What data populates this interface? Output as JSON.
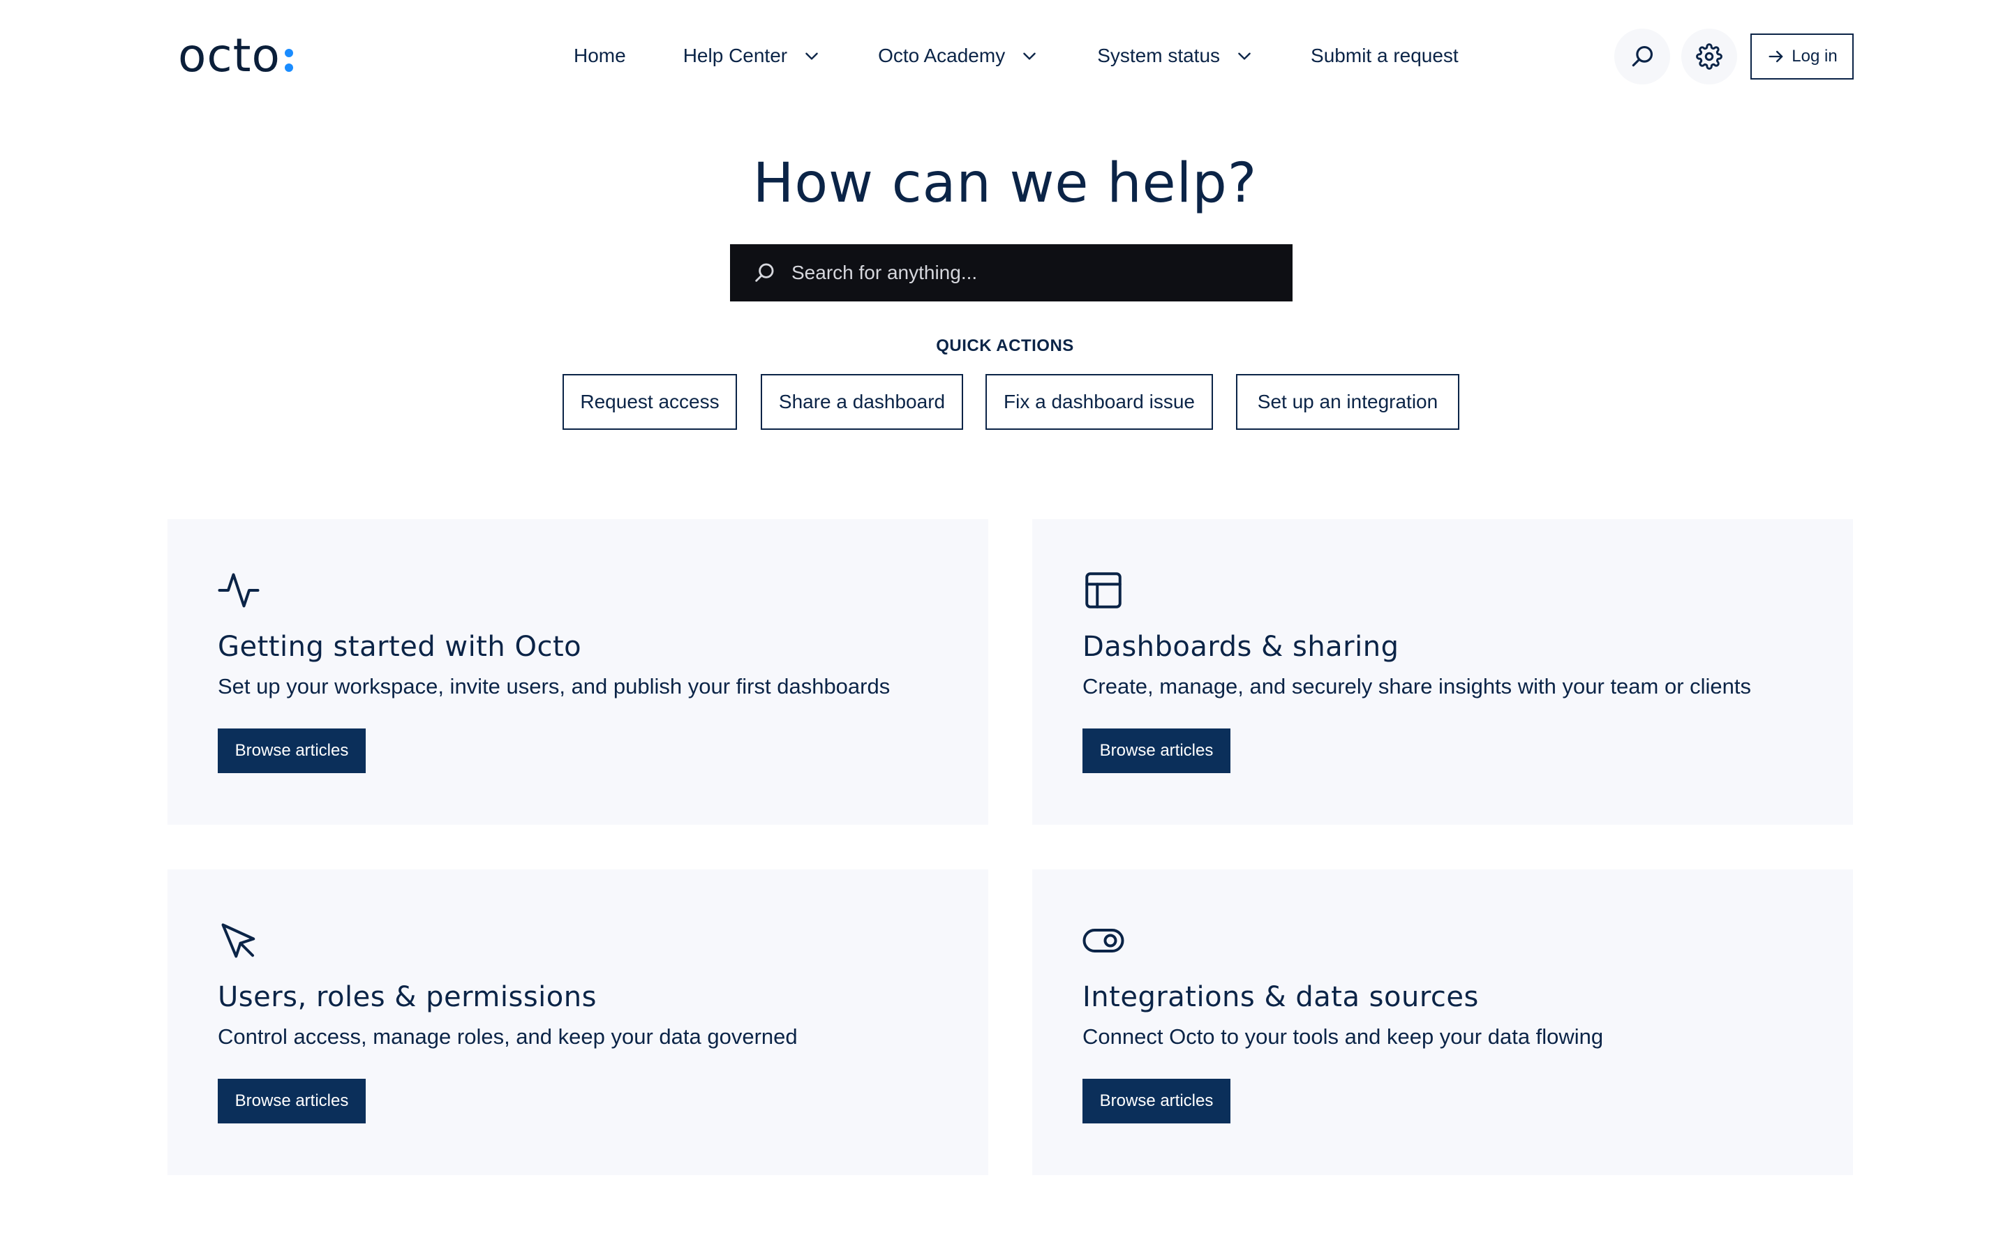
{
  "brand": {
    "name": "octo",
    "accent": "#1a8cff",
    "primary": "#0b2447",
    "button_bg": "#0b2f5a"
  },
  "nav": {
    "items": [
      {
        "label": "Home",
        "has_dropdown": false
      },
      {
        "label": "Help Center",
        "has_dropdown": true
      },
      {
        "label": "Octo Academy",
        "has_dropdown": true
      },
      {
        "label": "System status",
        "has_dropdown": true
      },
      {
        "label": "Submit a request",
        "has_dropdown": false
      }
    ],
    "search_icon": "search-icon",
    "settings_icon": "gear-icon",
    "login_label": "Log in"
  },
  "hero": {
    "title": "How can we help?",
    "search_placeholder": "Search for anything..."
  },
  "quick_actions": {
    "label": "QUICK ACTIONS",
    "items": [
      "Request access",
      "Share a dashboard",
      "Fix a dashboard issue",
      "Set up an integration"
    ]
  },
  "categories": [
    {
      "icon": "activity-icon",
      "title": "Getting started with Octo",
      "description": "Set up your workspace, invite users, and publish your first dashboards",
      "button": "Browse articles"
    },
    {
      "icon": "layout-icon",
      "title": "Dashboards & sharing",
      "description": "Create, manage, and securely share insights with your team or clients",
      "button": "Browse articles"
    },
    {
      "icon": "cursor-icon",
      "title": "Users, roles & permissions",
      "description": "Control access, manage roles, and keep your data governed",
      "button": "Browse articles"
    },
    {
      "icon": "toggle-icon",
      "title": "Integrations & data sources",
      "description": "Connect Octo to your tools and keep your data flowing",
      "button": "Browse articles"
    }
  ]
}
